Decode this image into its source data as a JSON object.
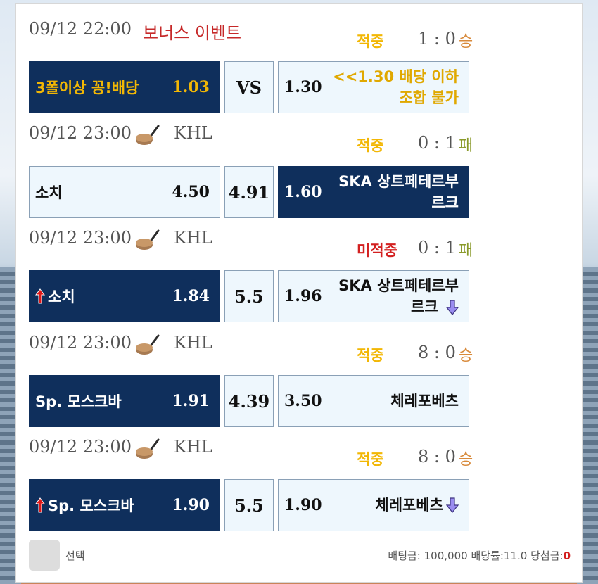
{
  "games": [
    {
      "time": "09/12 22:00",
      "label": "보너스 이벤트",
      "status": "적중",
      "score": "1 : 0",
      "outcome": "승",
      "home": "3폴이상 꽁!배당",
      "home_odd": "1.03",
      "middle": "VS",
      "away_odd": "1.30",
      "away_line1": "<<1.30 배당 이하",
      "away_line2": "조합 불가"
    },
    {
      "time": "09/12 23:00",
      "league": "KHL",
      "status": "적중",
      "score": "0 : 1",
      "outcome": "패",
      "home": "소치",
      "home_odd": "4.50",
      "middle": "4.91",
      "away_odd": "1.60",
      "away_line1": "SKA 상트페테르부",
      "away_line2": "르크"
    },
    {
      "time": "09/12 23:00",
      "league": "KHL",
      "status": "미적중",
      "score": "0 : 1",
      "outcome": "패",
      "home": "소치",
      "home_odd": "1.84",
      "middle": "5.5",
      "away_odd": "1.96",
      "away_line1": "SKA 상트페테르부",
      "away_line2": "르크"
    },
    {
      "time": "09/12 23:00",
      "league": "KHL",
      "status": "적중",
      "score": "8 : 0",
      "outcome": "승",
      "home": "Sp. 모스크바",
      "home_odd": "1.91",
      "middle": "4.39",
      "away_odd": "3.50",
      "away_line1": "체레포베츠"
    },
    {
      "time": "09/12 23:00",
      "league": "KHL",
      "status": "적중",
      "score": "8 : 0",
      "outcome": "승",
      "home": "Sp. 모스크바",
      "home_odd": "1.90",
      "middle": "5.5",
      "away_odd": "1.90",
      "away_line1": "체레포베츠"
    }
  ],
  "footer": {
    "select_label": "선택",
    "bet_amount_label": "배팅금: 100,000",
    "odds_label": "배당률:11.0",
    "payout_label": "당첨금:",
    "payout_value": "0"
  },
  "icons": {
    "league_icon": "hockey-stick-puck-icon",
    "up_arrow": "red-up-arrow-icon",
    "down_arrow": "purple-down-arrow-icon"
  },
  "colors": {
    "selected_bg": "#0f2f5c",
    "unselected_bg": "#eef7fd",
    "hit": "#f2b705",
    "miss": "#d32020",
    "win": "#d88a3b",
    "loss": "#8a9a2a"
  }
}
